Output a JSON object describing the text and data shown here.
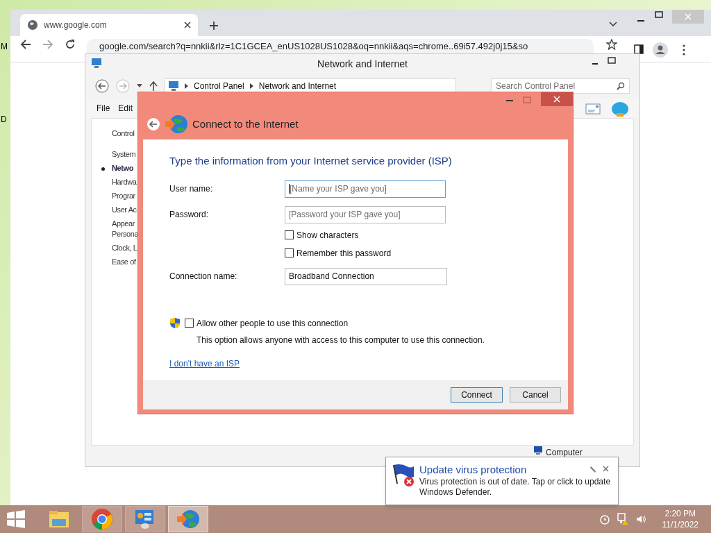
{
  "desktop": {
    "edge_labels": [
      "M",
      "D"
    ]
  },
  "browser": {
    "tab": {
      "title": "www.google.com"
    },
    "address": "google.com/search?q=nnkii&rlz=1C1GCEA_enUS1028US1028&oq=nnkii&aqs=chrome..69i57.492j0j15&so"
  },
  "control_panel": {
    "title": "Network and Internet",
    "breadcrumb": [
      "Control Panel",
      "Network and Internet"
    ],
    "search": {
      "placeholder": "Search Control Panel"
    },
    "menu": [
      "File",
      "Edit"
    ],
    "sidebar": [
      {
        "label": "Control",
        "selected": false
      },
      {
        "label": "System",
        "selected": false
      },
      {
        "label": "Netwo",
        "selected": true
      },
      {
        "label": "Hardwa",
        "selected": false
      },
      {
        "label": "Prograr",
        "selected": false
      },
      {
        "label": "User Ac",
        "selected": false
      },
      {
        "label": "Appear\nPersona",
        "selected": false
      },
      {
        "label": "Clock, L",
        "selected": false
      },
      {
        "label": "Ease of",
        "selected": false
      }
    ],
    "status": "Computer"
  },
  "dialog": {
    "title": "Connect to the Internet",
    "heading": "Type the information from your Internet service provider (ISP)",
    "fields": [
      {
        "label": "User name:",
        "placeholder": "[Name your ISP gave you]",
        "focused": true
      },
      {
        "label": "Password:",
        "placeholder": "[Password your ISP gave you]",
        "focused": false
      }
    ],
    "checkboxes": [
      {
        "label": "Show characters",
        "checked": false
      },
      {
        "label": "Remember this password",
        "checked": false
      }
    ],
    "connection": {
      "label": "Connection name:",
      "value": "Broadband Connection"
    },
    "allow": {
      "label": "Allow other people to use this connection",
      "checked": false,
      "note": "This option allows anyone with access to this computer to use this connection."
    },
    "link": "I don't have an ISP",
    "buttons": [
      {
        "label": "Connect",
        "default": true
      },
      {
        "label": "Cancel",
        "default": false
      }
    ]
  },
  "notification": {
    "title": "Update virus protection",
    "message": "Virus protection is out of date. Tap or click to update Windows Defender."
  },
  "taskbar": {
    "apps": [
      {
        "kind": "explorer",
        "selected": false
      },
      {
        "kind": "chrome",
        "selected": false
      },
      {
        "kind": "control",
        "selected": false
      },
      {
        "kind": "connect",
        "selected": true
      }
    ],
    "time": "2:20 PM",
    "date": "11/1/2022"
  }
}
